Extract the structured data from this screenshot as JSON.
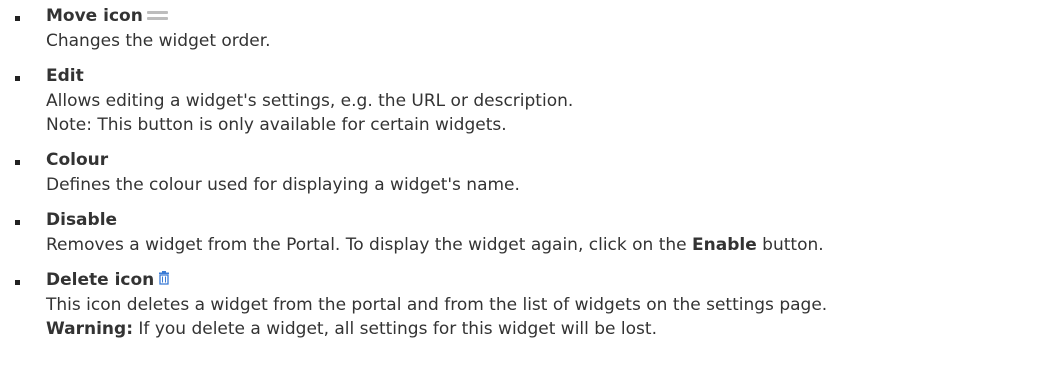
{
  "items": [
    {
      "title": "Move icon",
      "icon": "drag-handle-icon",
      "lines": [
        "Changes the widget order."
      ]
    },
    {
      "title": "Edit",
      "lines": [
        "Allows editing a widget's settings, e.g. the URL or description.",
        "Note: This button is only available for certain widgets."
      ]
    },
    {
      "title": "Colour",
      "lines": [
        "Defines the colour used for displaying a widget's name."
      ]
    },
    {
      "title": "Disable",
      "line_prefix": "Removes a widget from the Portal. To display the widget again, click on the ",
      "line_bold": "Enable",
      "line_suffix": " button."
    },
    {
      "title": "Delete icon",
      "icon": "trash-icon",
      "line1": "This icon deletes a widget from the portal and from the list of widgets on the settings page.",
      "warning_label": "Warning:",
      "warning_text": " If you delete a widget, all settings for this widget will be lost."
    }
  ],
  "colors": {
    "text": "#333333",
    "bullet": "#222222",
    "move_icon": "#bdbdbd",
    "trash_icon": "#3a7bd5"
  }
}
